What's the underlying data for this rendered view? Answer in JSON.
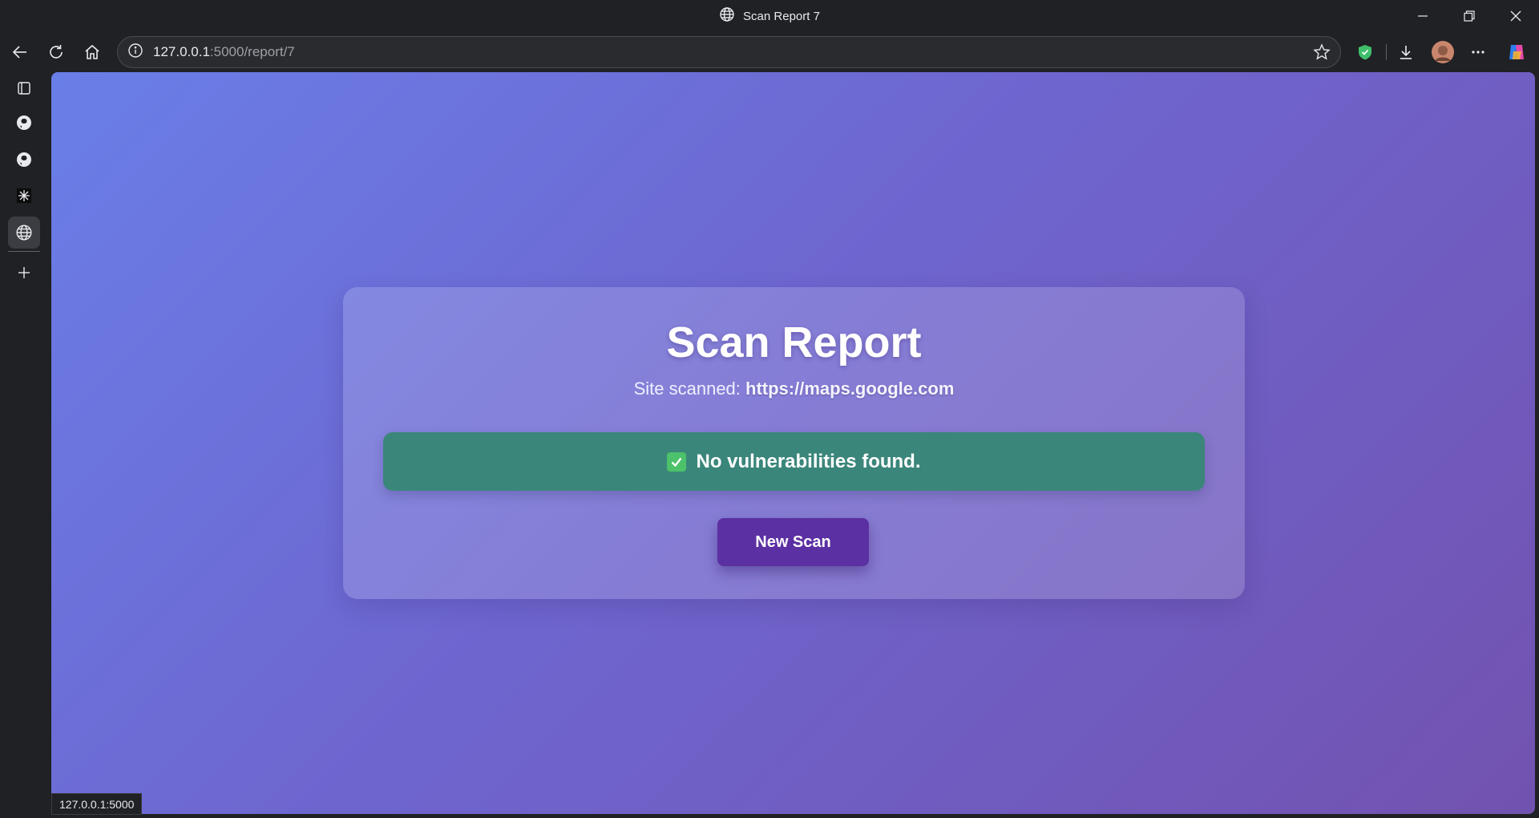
{
  "window": {
    "tab_title": "Scan Report 7"
  },
  "toolbar": {
    "url_host": "127.0.0.1",
    "url_rest": ":5000/report/7"
  },
  "page": {
    "title": "Scan Report",
    "site_label": "Site scanned:",
    "site_url": "https://maps.google.com",
    "result_text": "No vulnerabilities found.",
    "new_scan_label": "New Scan",
    "colors": {
      "result_bg": "#3b867b",
      "button_bg": "#5b30a2",
      "gradient_start": "#6a7ee8",
      "gradient_end": "#7252b0"
    }
  },
  "status": {
    "hover_url": "127.0.0.1:5000"
  },
  "icons": {
    "titlebar": "globe-icon",
    "sidebar": [
      "tab-panel-icon",
      "github-icon",
      "github-icon",
      "app-icon",
      "globe-icon",
      "plus-icon"
    ],
    "toolbar": [
      "back-icon",
      "reload-icon",
      "home-icon",
      "info-icon",
      "star-icon",
      "shield-icon",
      "download-icon",
      "avatar",
      "more-icon",
      "copilot-icon"
    ]
  }
}
